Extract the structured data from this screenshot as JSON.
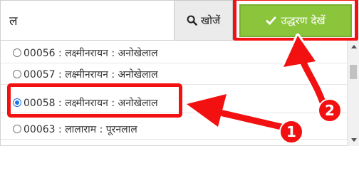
{
  "search": {
    "query": "ल",
    "search_button_label": "खोजें",
    "verify_button_label": "उद्धरण देखें"
  },
  "results": {
    "rows": [
      {
        "label": "00056 : लक्ष्मीनरायन : अनोखेलाल",
        "selected": false
      },
      {
        "label": "00057 : लक्ष्मीनरायन : अनोखेलाल",
        "selected": false
      },
      {
        "label": "00058 : लक्ष्मीनरायन : अनोखेलाल",
        "selected": true
      },
      {
        "label": "00063 : लालाराम : पूरनलाल",
        "selected": false
      }
    ]
  },
  "annotations": {
    "step_1": "1",
    "step_2": "2"
  },
  "colors": {
    "annotation": "#f21010",
    "verify_button": "#8ac53c",
    "radio_selected": "#1a73e8"
  },
  "icons": {
    "search_button": "search-icon",
    "verify_button": "check-icon"
  }
}
